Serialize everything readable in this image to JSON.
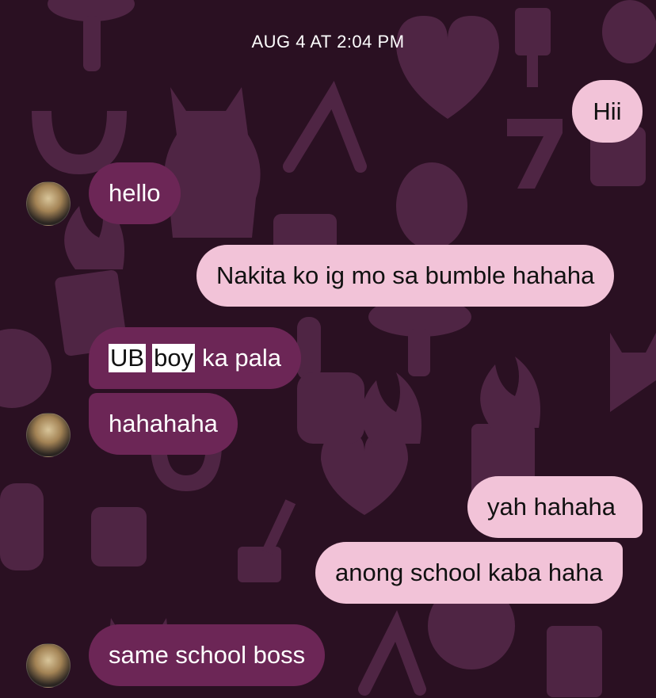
{
  "chat": {
    "timestamp": "AUG 4 AT 2:04 PM",
    "messages": [
      {
        "from": "me",
        "text": "Hii"
      },
      {
        "from": "them",
        "text": "hello"
      },
      {
        "from": "me",
        "text": "Nakita ko ig mo sa bumble hahaha"
      },
      {
        "from": "them",
        "parts": [
          "UB",
          "boy",
          "ka pala"
        ]
      },
      {
        "from": "them",
        "text": "hahahaha"
      },
      {
        "from": "me",
        "text": "yah hahaha"
      },
      {
        "from": "me",
        "text": "anong school kaba haha"
      },
      {
        "from": "them",
        "text": "same school boss"
      }
    ]
  },
  "colors": {
    "background": "#2a1022",
    "incoming_bubble": "#6c2656",
    "outgoing_bubble": "#f2c3d8",
    "highlight": "#ffffff"
  },
  "icons": [
    "horseshoe-icon",
    "lucky-cat-icon",
    "wishbone-icon",
    "heart-icon",
    "key-icon",
    "dice-icon",
    "beetle-icon",
    "mushroom-icon",
    "playing-card-icon",
    "eight-ball-icon",
    "flame-icon",
    "seven-icon"
  ]
}
